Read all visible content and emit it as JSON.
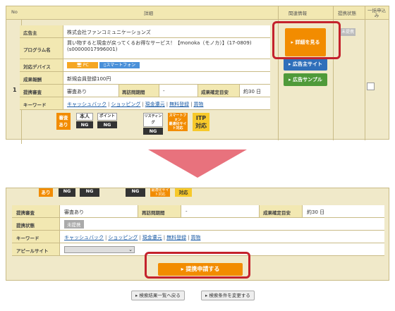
{
  "top": {
    "header": {
      "no": "No",
      "detail": "詳細",
      "related": "関連情報",
      "status": "提携状態",
      "bulk": "一括申込み"
    },
    "row_number": "1",
    "rows": {
      "advertiser_label": "広告主",
      "advertiser_value": "株式会社ファンコミュニケーションズ",
      "program_label": "プログラム名",
      "program_value": "買い物すると現金が戻ってくるお得なサービス！【monoka（モノカ）】(17-0809)(s00000017996001)",
      "device_label": "対応デバイス",
      "device_pc": "PC",
      "device_sp": "スマートフォン",
      "reward_label": "成果報酬",
      "reward_value": "新規会員登録100円",
      "review_label": "提携審査",
      "review_value": "審査あり",
      "revisit_label": "再訪問期間",
      "revisit_value": "-",
      "confirm_label": "成果確定目安",
      "confirm_value": "約30 日",
      "keyword_label": "キーワード",
      "keywords": [
        "キャッシュバック",
        "ショッピング",
        "現金還元",
        "無料登録",
        "買物"
      ]
    },
    "tags": [
      {
        "top": "審査",
        "bot": "あり"
      },
      {
        "top": "本人",
        "bot": "NG"
      },
      {
        "top": "ポイント",
        "bot": "NG"
      },
      {
        "top": "リスティング",
        "bot": "NG"
      },
      {
        "top": "スマートフォン",
        "bot": "最適化サイト対応"
      },
      {
        "top": "ITP",
        "bot": "対応"
      }
    ],
    "buttons": {
      "detail": "▸ 詳細を見る",
      "site": "▸ 広告主サイト",
      "sample": "▸ 広告サンプル"
    },
    "teikei_badge": "未提携"
  },
  "bottom": {
    "tags": {
      "ari": "あり",
      "ng": "NG",
      "smart": "最適化サイト対応",
      "taio": "対応"
    },
    "review_label": "提携審査",
    "review_value": "審査あり",
    "revisit_label": "再訪問期間",
    "revisit_value": "-",
    "confirm_label": "成果確定目安",
    "confirm_value": "約30 日",
    "status_label": "提携状態",
    "status_value": "未提携",
    "keyword_label": "キーワード",
    "keywords": [
      "キャッシュバック",
      "ショッピング",
      "現金還元",
      "無料登録",
      "買物"
    ],
    "appeal_label": "アピールサイト",
    "apply_button": "▸ 提携申請する",
    "back_button": "▸ 検索結果一覧へ戻る",
    "change_button": "▸ 検索条件を変更する"
  },
  "colors": {
    "accent": "#f28c00",
    "highlight": "#c4222c",
    "arrow": "#e8727d",
    "link": "#1b5ba5"
  }
}
